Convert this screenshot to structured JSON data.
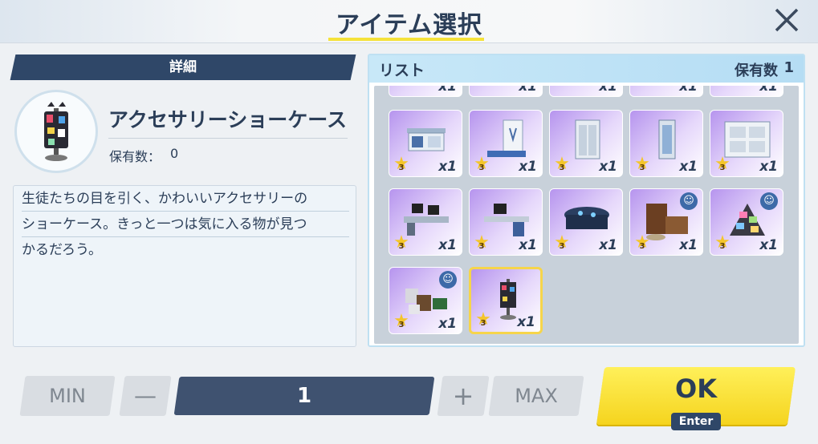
{
  "header": {
    "title": "アイテム選択",
    "close_icon": "close-icon"
  },
  "detail": {
    "header_label": "詳細",
    "item_name": "アクセサリーショーケース",
    "owned_label": "保有数：",
    "owned_value": "0",
    "description_lines": [
      "生徒たちの目を引く、かわいいアクセサリーの",
      "ショーケース。きっと一つは気に入る物が見つ",
      "かるだろう。"
    ]
  },
  "list": {
    "title": "リスト",
    "count_label": "保有数",
    "count_value": "1",
    "partial_row_qty": [
      "x1",
      "x1",
      "x1",
      "x1",
      "x1"
    ],
    "items": [
      {
        "name": "counter",
        "star": "3",
        "qty": "x1",
        "badge": false
      },
      {
        "name": "partition-panel",
        "star": "3",
        "qty": "x1",
        "badge": false
      },
      {
        "name": "locker",
        "star": "3",
        "qty": "x1",
        "badge": false
      },
      {
        "name": "door-frame",
        "star": "3",
        "qty": "x1",
        "badge": false
      },
      {
        "name": "shelf-wall",
        "star": "3",
        "qty": "x1",
        "badge": false
      },
      {
        "name": "office-desk-monitors",
        "star": "3",
        "qty": "x1",
        "badge": false
      },
      {
        "name": "computer-desk",
        "star": "3",
        "qty": "x1",
        "badge": false
      },
      {
        "name": "command-table",
        "star": "3",
        "qty": "x1",
        "badge": false
      },
      {
        "name": "bookshelf-set",
        "star": "3",
        "qty": "x1",
        "badge": true
      },
      {
        "name": "tv-pile",
        "star": "3",
        "qty": "x1",
        "badge": true
      },
      {
        "name": "rubble-pile",
        "star": "3",
        "qty": "x1",
        "badge": true
      },
      {
        "name": "accessory-showcase",
        "star": "3",
        "qty": "x1",
        "badge": false,
        "selected": true
      }
    ]
  },
  "controls": {
    "min_label": "MIN",
    "minus_label": "—",
    "quantity": "1",
    "plus_label": "+",
    "max_label": "MAX",
    "ok_label": "OK",
    "ok_shortcut": "Enter"
  },
  "colors": {
    "accent_yellow": "#f5d41e",
    "navy": "#2f4768",
    "card_purple": "#b694ee"
  }
}
